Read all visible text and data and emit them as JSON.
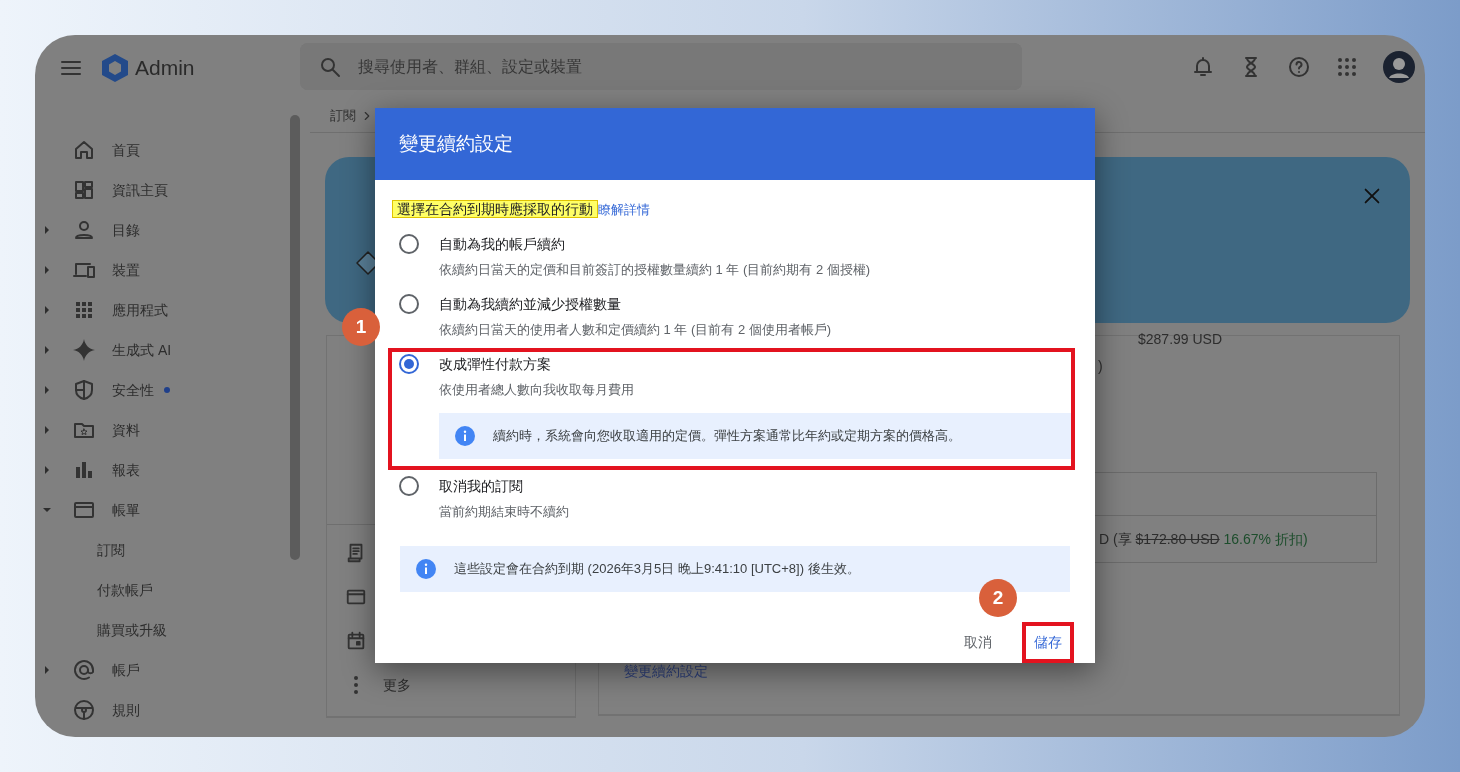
{
  "app_bar": {
    "product": "Admin",
    "search": {
      "placeholder": "搜尋使用者、群組、設定或裝置"
    }
  },
  "sidebar": {
    "items": [
      {
        "label": "首頁",
        "notice": false
      },
      {
        "label": "資訊主頁",
        "notice": false
      },
      {
        "label": "目錄",
        "expanded": false,
        "notice": false
      },
      {
        "label": "裝置",
        "expanded": false,
        "notice": false
      },
      {
        "label": "應用程式",
        "expanded": false,
        "notice": false
      },
      {
        "label": "生成式 AI",
        "expanded": false,
        "notice": false
      },
      {
        "label": "安全性",
        "expanded": false,
        "notice": true
      },
      {
        "label": "資料",
        "expanded": false,
        "notice": false
      },
      {
        "label": "報表",
        "expanded": false,
        "notice": false
      },
      {
        "label": "帳單",
        "expanded": true,
        "notice": false,
        "children": [
          {
            "label": "訂閱"
          },
          {
            "label": "付款帳戶"
          },
          {
            "label": "購買或升級"
          }
        ]
      },
      {
        "label": "帳戶",
        "expanded": false,
        "notice": false
      },
      {
        "label": "規則",
        "notice": false
      }
    ]
  },
  "breadcrumb": [
    {
      "label": "訂閱"
    }
  ],
  "side_card": {
    "more": "更多"
  },
  "main_card": {
    "price": "$287.99 USD",
    "text_tail": ")",
    "table_row": {
      "prefix": "D (享",
      "original_price": "$172.80 USD",
      "discount": "16.67% 折扣)"
    },
    "link": "變更續約設定"
  },
  "dialog": {
    "title": "變更續約設定",
    "intro": "選擇在合約到期時應採取的行動",
    "intro_highlighted": true,
    "learn_more": "瞭解詳情",
    "options": [
      {
        "title": "自動為我的帳戶續約",
        "description": "依續約日當天的定價和目前簽訂的授權數量續約 1 年 (目前約期有 2 個授權)",
        "selected": false,
        "highlighted": false
      },
      {
        "title": "自動為我續約並減少授權數量",
        "description": "依續約日當天的使用者人數和定價續約 1 年 (目前有 2 個使用者帳戶)",
        "selected": false,
        "highlighted": false
      },
      {
        "title": "改成彈性付款方案",
        "description": "依使用者總人數向我收取每月費用",
        "selected": true,
        "highlighted": true,
        "note": "續約時，系統會向您收取適用的定價。彈性方案通常比年約或定期方案的價格高。"
      },
      {
        "title": "取消我的訂閱",
        "description": "當前約期結束時不續約",
        "selected": false,
        "highlighted": false
      }
    ],
    "footer_note": "這些設定會在合約到期 (2026年3月5日 晚上9:41:10 [UTC+8]) 後生效。",
    "buttons": [
      {
        "label": "取消",
        "kind": "secondary",
        "highlighted": false
      },
      {
        "label": "儲存",
        "kind": "primary",
        "highlighted": true
      }
    ]
  },
  "annotations": [
    {
      "label": "1"
    },
    {
      "label": "2"
    }
  ]
}
